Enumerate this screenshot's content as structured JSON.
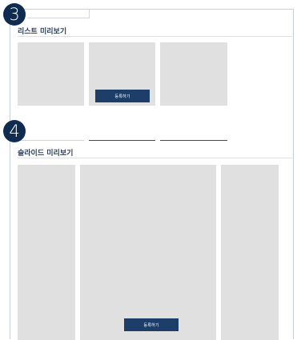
{
  "markers": {
    "list_step": "3",
    "slide_step": "4"
  },
  "list_preview": {
    "title": "리스트 미리보기",
    "register_button": "등록하기"
  },
  "slide_preview": {
    "title": "슬라이드 미리보기",
    "register_button": "등록하기"
  },
  "colors": {
    "marker": "#0f2b4f",
    "button": "#1d3e69",
    "placeholder": "#e0e0e0"
  }
}
